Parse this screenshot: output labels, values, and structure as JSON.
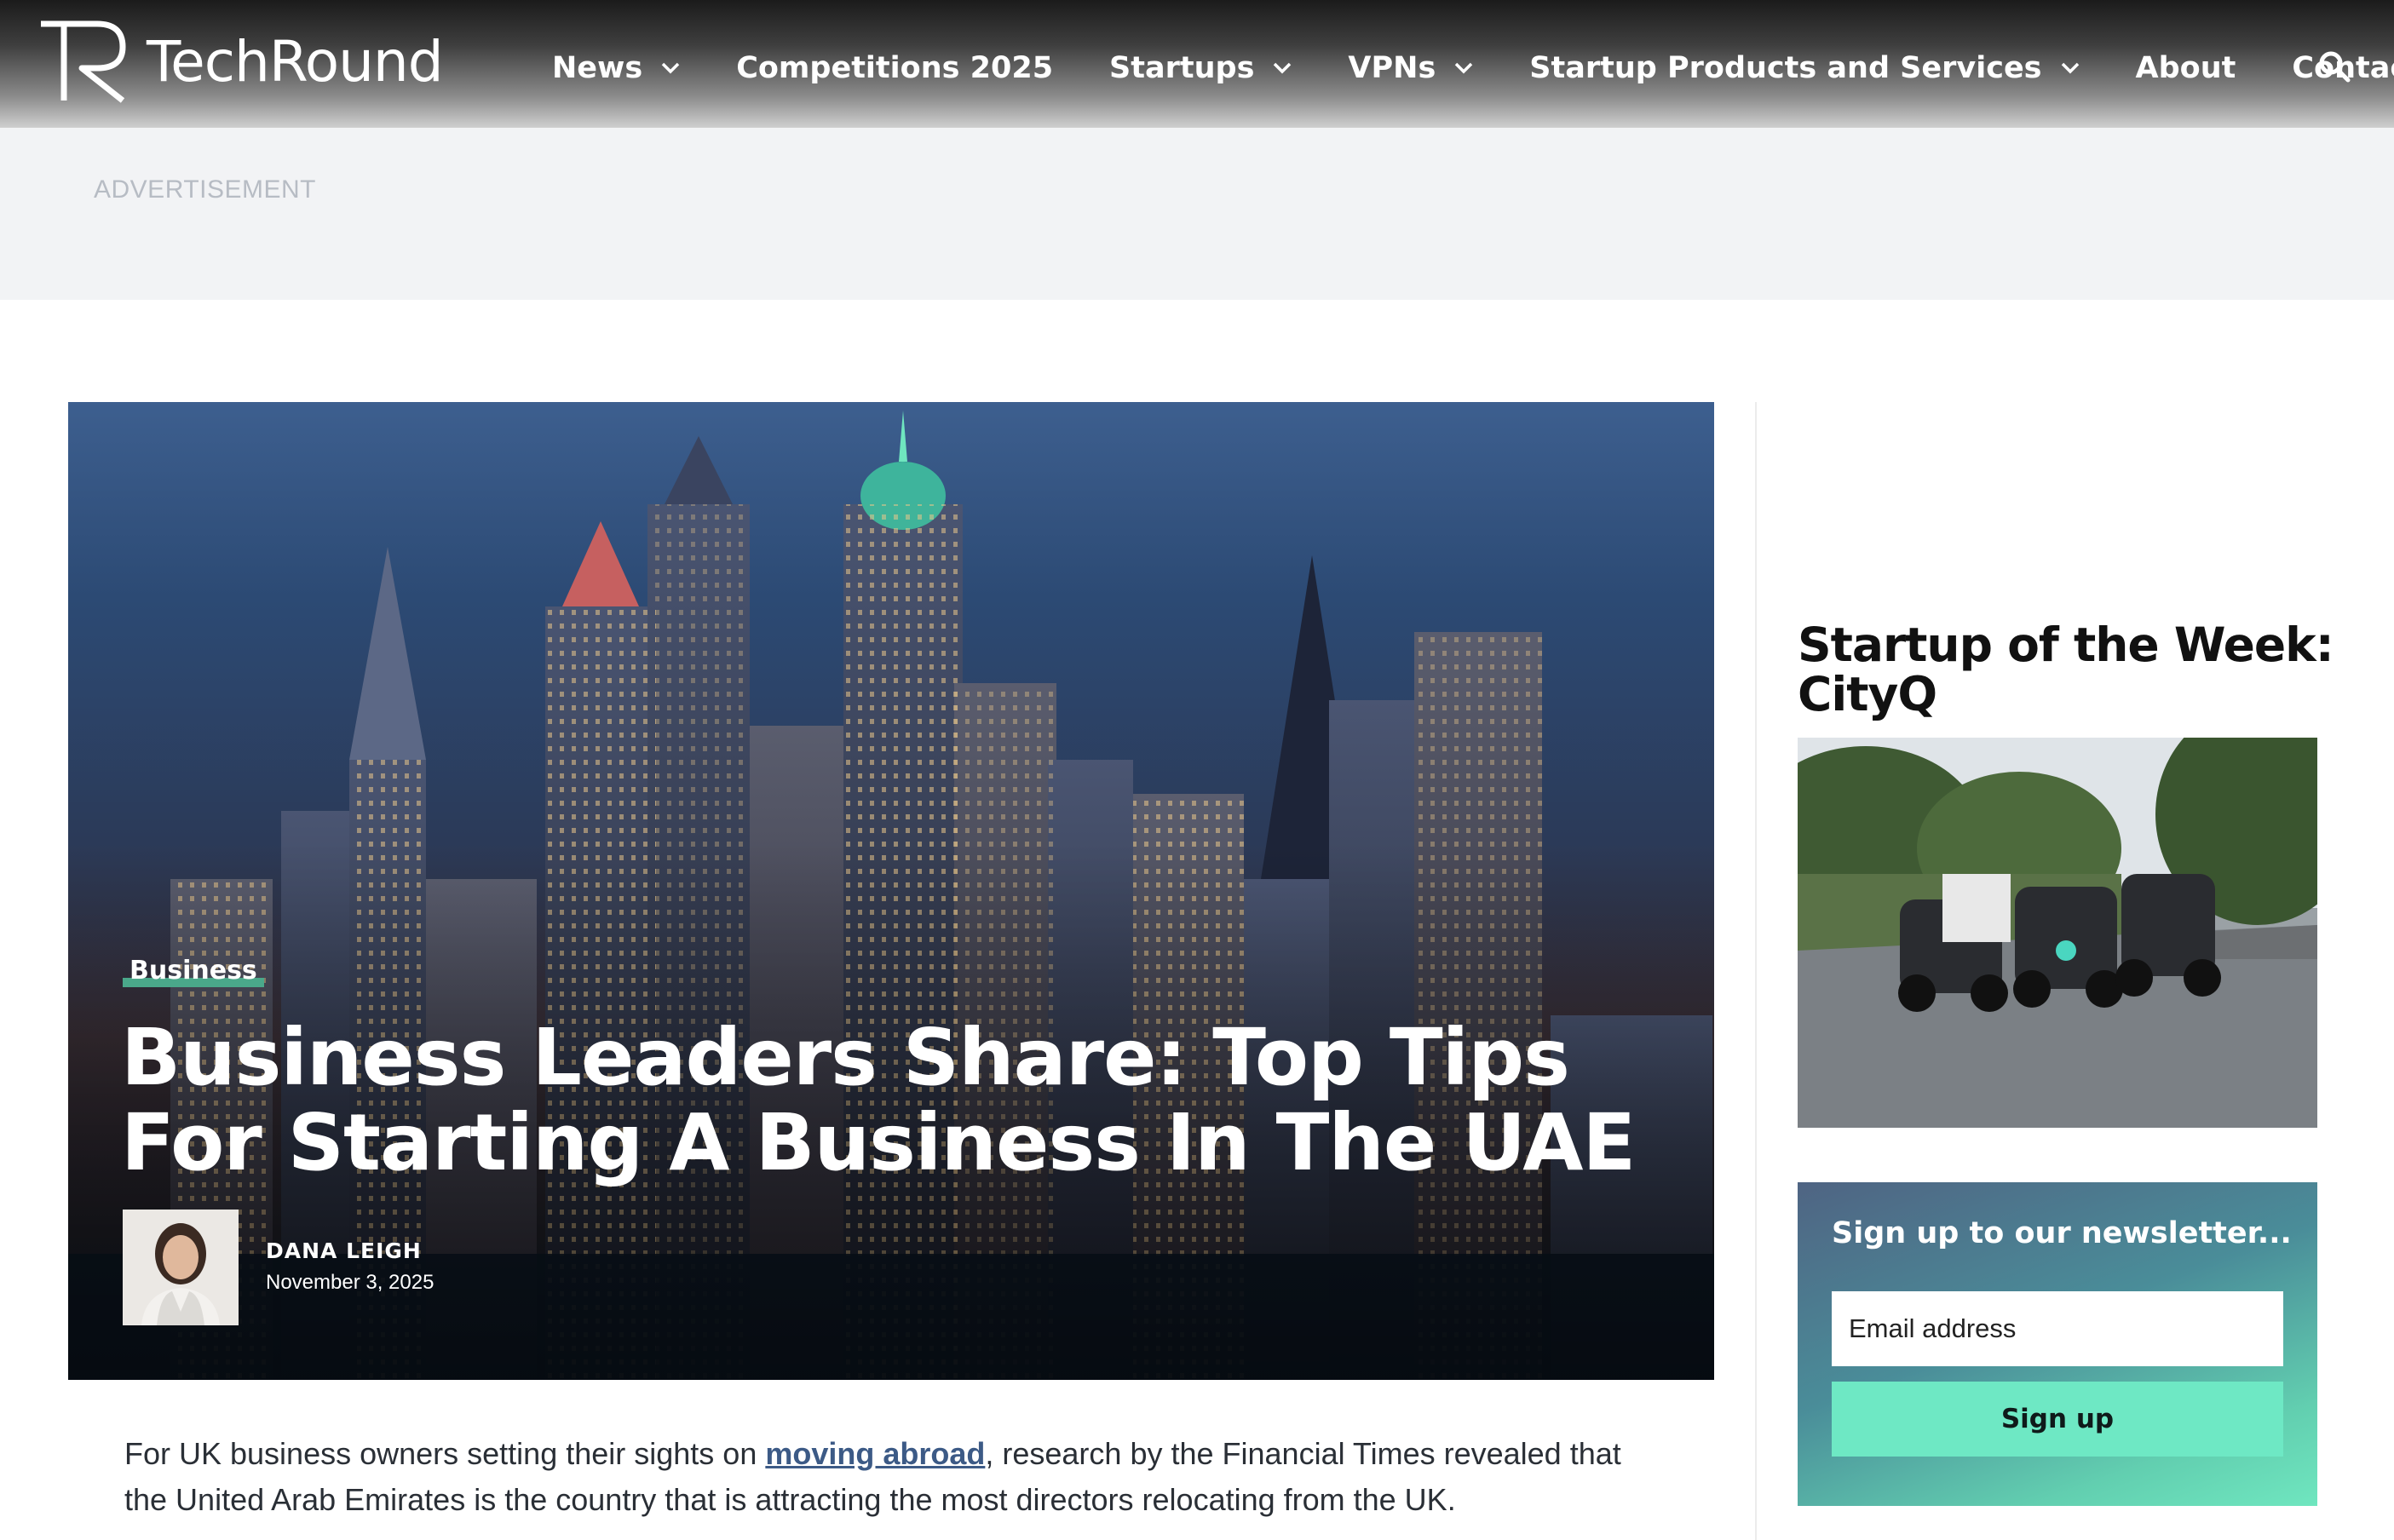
{
  "header": {
    "logo_text": "TechRound",
    "nav": [
      {
        "label": "News",
        "has_dropdown": true
      },
      {
        "label": "Competitions 2025",
        "has_dropdown": false
      },
      {
        "label": "Startups",
        "has_dropdown": true
      },
      {
        "label": "VPNs",
        "has_dropdown": true
      },
      {
        "label": "Startup Products and Services",
        "has_dropdown": true
      },
      {
        "label": "About",
        "has_dropdown": false
      },
      {
        "label": "Contact",
        "has_dropdown": false
      }
    ],
    "search_icon": "search-icon"
  },
  "ad": {
    "label": "ADVERTISEMENT"
  },
  "hero": {
    "category": "Business",
    "title": "Business Leaders Share: Top Tips For Starting A Business In The UAE",
    "author": "DANA LEIGH",
    "date": "November 3, 2025"
  },
  "article": {
    "intro_before": "For UK business owners setting their sights on ",
    "intro_link": "moving abroad",
    "intro_after": ", research by the Financial Times revealed that the United Arab Emirates is the country that is attracting the most directors relocating from the UK."
  },
  "sidebar": {
    "startup_of_week_title": "Startup of the Week: CityQ",
    "newsletter": {
      "title": "Sign up to our newsletter...",
      "email_placeholder": "Email address",
      "button_label": "Sign up"
    }
  },
  "colors": {
    "accent_green": "#6ee8c4",
    "link_blue": "#3c5a86",
    "category_underline": "#4aa88a"
  }
}
